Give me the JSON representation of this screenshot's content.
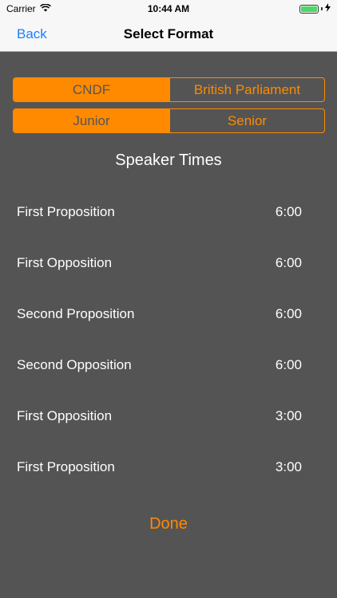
{
  "status_bar": {
    "carrier": "Carrier",
    "time": "10:44 AM"
  },
  "nav": {
    "back_label": "Back",
    "title": "Select Format"
  },
  "format_segment": {
    "options": [
      "CNDF",
      "British Parliament"
    ],
    "selected": "CNDF"
  },
  "level_segment": {
    "options": [
      "Junior",
      "Senior"
    ],
    "selected": "Junior"
  },
  "section_title": "Speaker Times",
  "speakers": [
    {
      "name": "First Proposition",
      "time": "6:00"
    },
    {
      "name": "First Opposition",
      "time": "6:00"
    },
    {
      "name": "Second Proposition",
      "time": "6:00"
    },
    {
      "name": "Second Opposition",
      "time": "6:00"
    },
    {
      "name": "First Opposition",
      "time": "3:00"
    },
    {
      "name": "First Proposition",
      "time": "3:00"
    }
  ],
  "done_label": "Done",
  "colors": {
    "accent": "#ff8a00",
    "background": "#545454",
    "link": "#1b7ef7"
  }
}
